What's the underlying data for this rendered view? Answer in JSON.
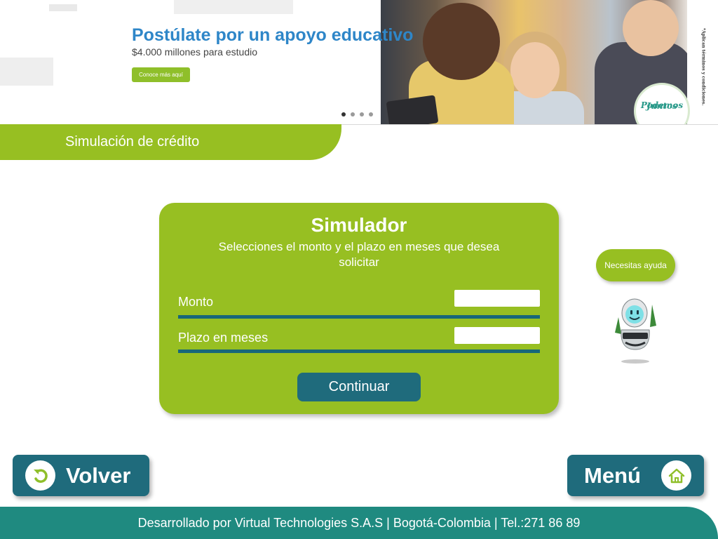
{
  "banner": {
    "title": "Postúlate por un apoyo educativo",
    "subtitle": "$4.000 millones para estudio",
    "cta_label": "Conoce más aquí",
    "logo_text_1": "Juntos",
    "logo_text_2": "Podemos",
    "legal_text": "*Aplican términos y condiciones.",
    "carousel_dots": 4,
    "carousel_active": 1
  },
  "section": {
    "title": "Simulación de crédito"
  },
  "simulator": {
    "title": "Simulador",
    "description": "Selecciones el monto y el plazo en meses que desea solicitar",
    "fields": [
      {
        "label": "Monto",
        "value": "",
        "placeholder": ""
      },
      {
        "label": "Plazo en meses",
        "value": "",
        "placeholder": ""
      }
    ],
    "continue_label": "Continuar"
  },
  "help": {
    "label": "Necesitas ayuda",
    "robot_icon": "robot-assistant-icon"
  },
  "nav": {
    "back_label": "Volver",
    "back_icon": "undo-arrow-icon",
    "menu_label": "Menú",
    "menu_icon": "home-icon"
  },
  "footer": {
    "text": "Desarrollado por Virtual Technologies S.A.S  |  Bogotá-Colombia  |  Tel.:271 86 89"
  },
  "colors": {
    "green": "#97bf22",
    "teal": "#1f6b7c",
    "footer_teal": "#1f8a80",
    "banner_blue": "#2e86c8"
  }
}
